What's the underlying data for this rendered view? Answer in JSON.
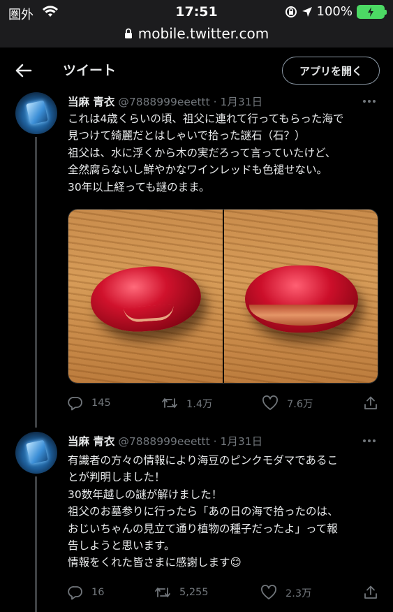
{
  "status_bar": {
    "carrier": "圏外",
    "time": "17:51",
    "battery": "100%"
  },
  "url_bar": {
    "url": "mobile.twitter.com"
  },
  "header": {
    "title": "ツイート",
    "open_app_label": "アプリを開く"
  },
  "tweets": [
    {
      "name": "当麻 青衣",
      "handle": "@7888999eeettt",
      "separator": "·",
      "date": "1月31日",
      "lines": [
        "これは4歳くらいの頃、祖父に連れて行ってもらった海で",
        "見つけて綺麗だとはしゃいで拾った謎石（石？）",
        "祖父は、水に浮くから木の実だろって言っていたけど、",
        "全然腐らないし鮮やかなワインレッドも色褪せない。",
        "30年以上経っても謎のまま。"
      ],
      "reply_count": "145",
      "retweet_count": "1.4万",
      "like_count": "7.6万"
    },
    {
      "name": "当麻 青衣",
      "handle": "@7888999eeettt",
      "separator": "·",
      "date": "1月31日",
      "lines": [
        "有識者の方々の情報により海豆のピンクモダマであるこ",
        "とが判明しました！",
        "30数年越しの謎が解けました！",
        "祖父のお墓参りに行ったら「あの日の海で拾ったのは、",
        "おじいちゃんの見立て通り植物の種子だったよ」って報",
        "告しようと思います。",
        "情報をくれた皆さまに感謝します😊"
      ],
      "reply_count": "16",
      "retweet_count": "5,255",
      "like_count": "2.3万"
    }
  ]
}
